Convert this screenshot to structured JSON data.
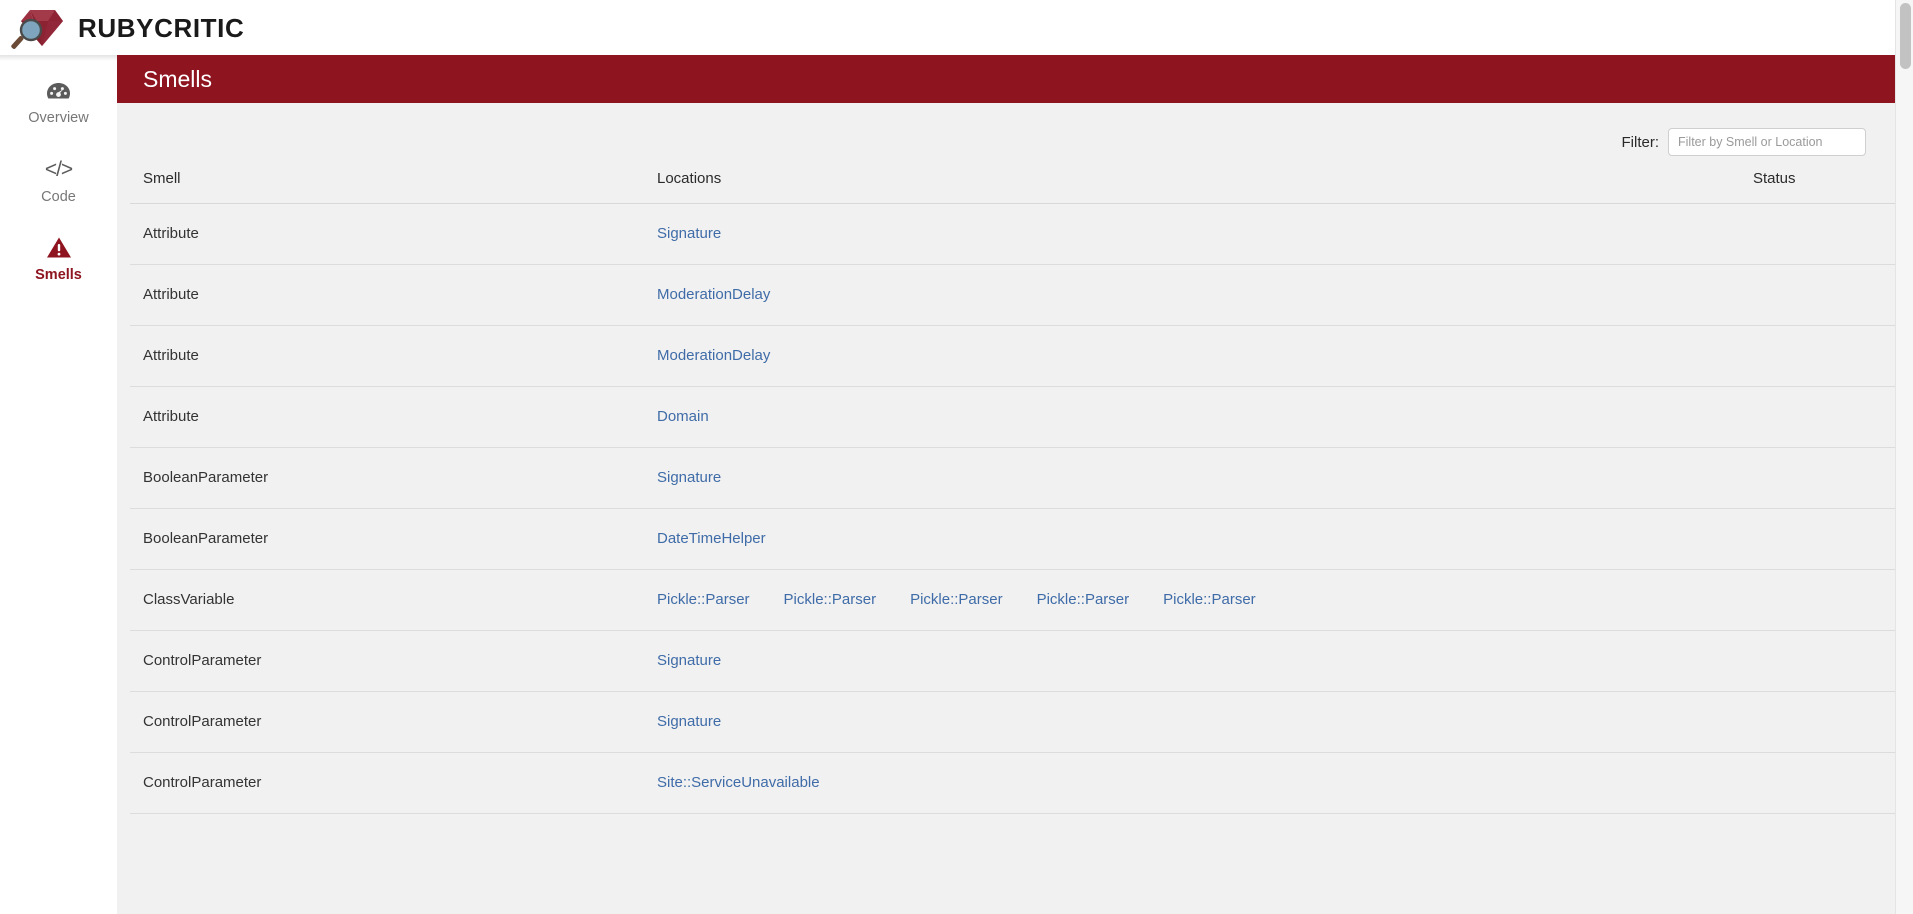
{
  "brand": {
    "title": "RUBYCRITIC",
    "logo_icon": "ruby-magnifier-icon"
  },
  "sidebar": {
    "items": [
      {
        "label": "Overview",
        "icon": "dashboard-gauge-icon",
        "active": false
      },
      {
        "label": "Code",
        "icon": "code-brackets-icon",
        "glyph": "</>",
        "active": false
      },
      {
        "label": "Smells",
        "icon": "warning-triangle-icon",
        "active": true
      }
    ]
  },
  "header": {
    "title": "Smells",
    "background_color": "#8e1420",
    "text_color": "#ffffff"
  },
  "filter": {
    "label": "Filter:",
    "value": "",
    "placeholder": "Filter by Smell or Location"
  },
  "table": {
    "columns": [
      "Smell",
      "Locations",
      "Status"
    ],
    "rows": [
      {
        "smell": "Attribute",
        "locations": [
          "Signature"
        ],
        "status": ""
      },
      {
        "smell": "Attribute",
        "locations": [
          "ModerationDelay"
        ],
        "status": ""
      },
      {
        "smell": "Attribute",
        "locations": [
          "ModerationDelay"
        ],
        "status": ""
      },
      {
        "smell": "Attribute",
        "locations": [
          "Domain"
        ],
        "status": ""
      },
      {
        "smell": "BooleanParameter",
        "locations": [
          "Signature"
        ],
        "status": ""
      },
      {
        "smell": "BooleanParameter",
        "locations": [
          "DateTimeHelper"
        ],
        "status": ""
      },
      {
        "smell": "ClassVariable",
        "locations": [
          "Pickle::Parser",
          "Pickle::Parser",
          "Pickle::Parser",
          "Pickle::Parser",
          "Pickle::Parser"
        ],
        "status": ""
      },
      {
        "smell": "ControlParameter",
        "locations": [
          "Signature"
        ],
        "status": ""
      },
      {
        "smell": "ControlParameter",
        "locations": [
          "Signature"
        ],
        "status": ""
      },
      {
        "smell": "ControlParameter",
        "locations": [
          "Site::ServiceUnavailable"
        ],
        "status": ""
      }
    ]
  },
  "colors": {
    "accent_red": "#8e1420",
    "link_blue": "#3f6ca8",
    "content_background": "#f1f1f1",
    "sidebar_background": "#ffffff"
  }
}
